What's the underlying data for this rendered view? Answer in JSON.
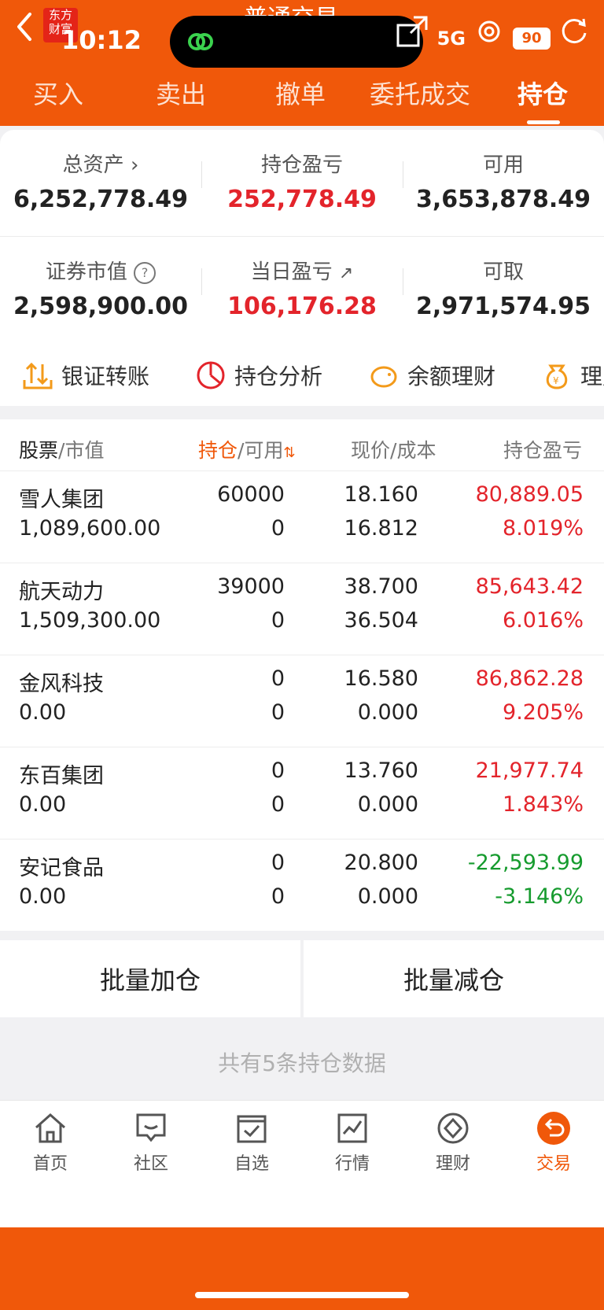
{
  "status": {
    "time": "10:12",
    "network": "5G",
    "battery": "90",
    "app_logo": "东方财富"
  },
  "header": {
    "title": "普通交易"
  },
  "tabs": [
    "买入",
    "卖出",
    "撤单",
    "委托成交",
    "持仓"
  ],
  "summary": {
    "total_assets_label": "总资产",
    "total_assets": "6,252,778.49",
    "position_pnl_label": "持仓盈亏",
    "position_pnl": "252,778.49",
    "available_label": "可用",
    "available": "3,653,878.49",
    "market_value_label": "证券市值",
    "market_value": "2,598,900.00",
    "daily_pnl_label": "当日盈亏",
    "daily_pnl": "106,176.28",
    "withdrawable_label": "可取",
    "withdrawable": "2,971,574.95"
  },
  "tools": [
    "银证转账",
    "持仓分析",
    "余额理财",
    "理财"
  ],
  "table": {
    "headers": {
      "stock": "股票",
      "mv": "市值",
      "pos": "持仓",
      "avail": "可用",
      "price": "现价",
      "cost": "成本",
      "pnl": "持仓盈亏"
    },
    "rows": [
      {
        "name": "雪人集团",
        "mv": "1,089,600.00",
        "pos": "60000",
        "avail": "0",
        "price": "18.160",
        "cost": "16.812",
        "pnl": "80,889.05",
        "pct": "8.019%"
      },
      {
        "name": "航天动力",
        "mv": "1,509,300.00",
        "pos": "39000",
        "avail": "0",
        "price": "38.700",
        "cost": "36.504",
        "pnl": "85,643.42",
        "pct": "6.016%"
      },
      {
        "name": "金风科技",
        "mv": "0.00",
        "pos": "0",
        "avail": "0",
        "price": "16.580",
        "cost": "0.000",
        "pnl": "86,862.28",
        "pct": "9.205%"
      },
      {
        "name": "东百集团",
        "mv": "0.00",
        "pos": "0",
        "avail": "0",
        "price": "13.760",
        "cost": "0.000",
        "pnl": "21,977.74",
        "pct": "1.843%"
      },
      {
        "name": "安记食品",
        "mv": "0.00",
        "pos": "0",
        "avail": "0",
        "price": "20.800",
        "cost": "0.000",
        "pnl": "-22,593.99",
        "pct": "-3.146%"
      }
    ]
  },
  "batch": {
    "add": "批量加仓",
    "reduce": "批量减仓"
  },
  "footer_note": "共有5条持仓数据",
  "nav": [
    "首页",
    "社区",
    "自选",
    "行情",
    "理财",
    "交易"
  ],
  "colors": {
    "brand": "#f0580a",
    "up": "#e3242b",
    "down": "#169b2e"
  }
}
